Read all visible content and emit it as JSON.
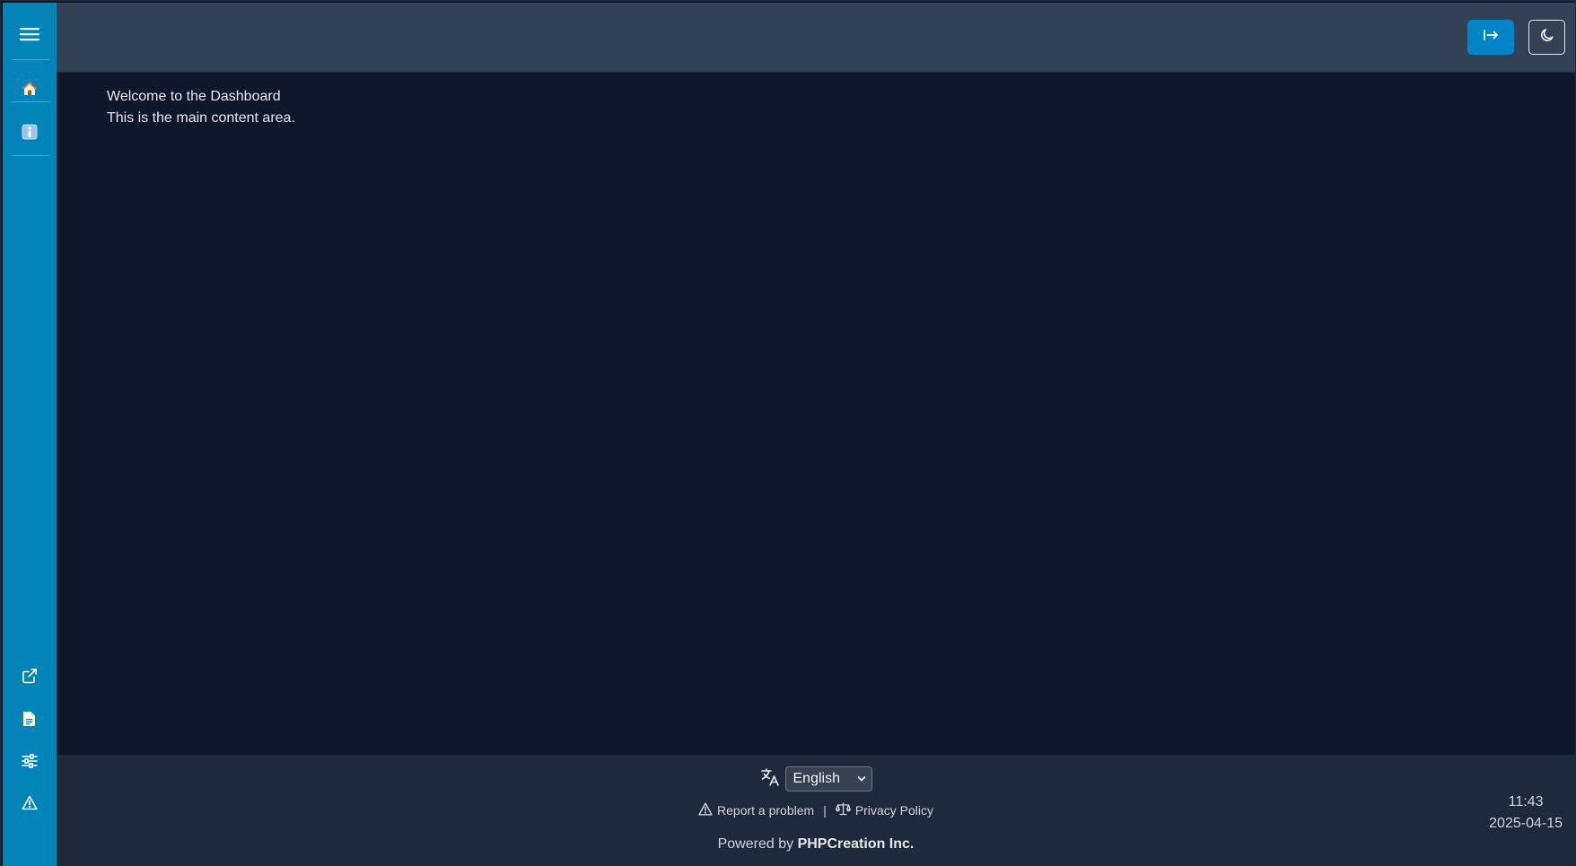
{
  "sidebar": {
    "top_items": [
      {
        "icon": "menu-icon"
      },
      {
        "icon": "home-icon"
      },
      {
        "icon": "info-icon"
      }
    ],
    "bottom_items": [
      {
        "icon": "external-link-icon"
      },
      {
        "icon": "document-icon"
      },
      {
        "icon": "sliders-icon"
      },
      {
        "icon": "warning-icon"
      }
    ],
    "color": "#0284b8"
  },
  "header": {
    "login_button_icon": "login-arrow-icon",
    "theme_button_icon": "moon-icon",
    "login_button_color": "#0284c7"
  },
  "main": {
    "welcome": "Welcome to the Dashboard",
    "subtitle": "This is the main content area."
  },
  "footer": {
    "language_icon": "translate-icon",
    "language_selected": "English",
    "report_label": "Report a problem",
    "separator": "|",
    "privacy_label": "Privacy Policy",
    "powered_prefix": "Powered by",
    "powered_company": "PHPCreation Inc.",
    "time": "11:43",
    "date": "2025-04-15"
  },
  "colors": {
    "background": "#0f172a",
    "header": "#334155",
    "footer": "#1e293b"
  }
}
